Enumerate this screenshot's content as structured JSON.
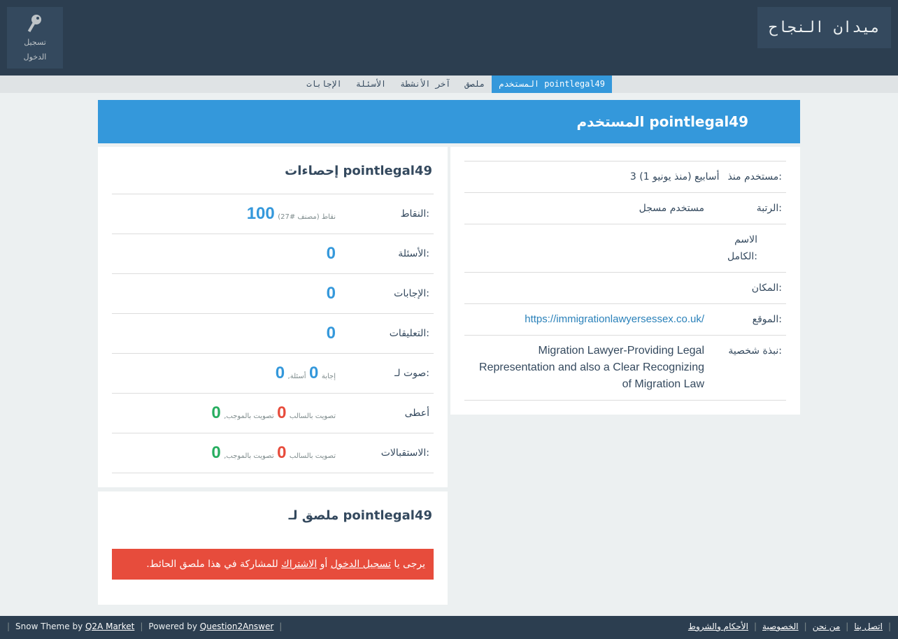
{
  "header": {
    "site_title": "ميدان النجاح",
    "login_label_1": "تسجيل",
    "login_label_2": "الدخول"
  },
  "nav": {
    "items": [
      {
        "label": "المستخدم pointlegal49",
        "active": true
      },
      {
        "label": "ملصق"
      },
      {
        "label": "آخر الأنشطة"
      },
      {
        "label": "الأسئلة"
      },
      {
        "label": "الإجابات"
      }
    ]
  },
  "page_title": "المستخدم pointlegal49",
  "profile": {
    "member_for_label": "مستخدم منذ:",
    "member_for_value": "3 أسابيع (منذ يونيو 1)",
    "type_label": "الرتبة:",
    "type_value": "مستخدم مسجل",
    "fullname_label_1": "الاسم",
    "fullname_label_2": "الكامل:",
    "location_label": "المكان:",
    "website_label": "الموقع:",
    "website_value": "https://immigrationlawyersessex.co.uk/",
    "about_label": "نبذة شخصية:",
    "about_value": "Migration Lawyer-Providing Legal Representation and also a Clear Recognizing of Migration Law"
  },
  "stats": {
    "title": "إحصاءات pointlegal49",
    "points_label": "النقاط:",
    "points_value": "100",
    "points_suffix": "نقاط (مصنف #27)",
    "questions_label": "الأسئلة:",
    "questions_value": "0",
    "answers_label": "الإجابات:",
    "answers_value": "0",
    "comments_label": "التعليقات:",
    "comments_value": "0",
    "voted_label": "صوت لـ:",
    "voted_q": "0",
    "voted_q_label": "أسئلة,",
    "voted_a": "0",
    "voted_a_label": "إجابة",
    "gave_label": "أعطى",
    "gave_up": "0",
    "gave_up_label": "تصويت بالموجب,",
    "gave_down": "0",
    "gave_down_label": "تصويت بالسالب",
    "received_label": "الاستقبالات:",
    "recv_up": "0",
    "recv_up_label": "تصويت بالموجب,",
    "recv_down": "0",
    "recv_down_label": "تصويت بالسالب"
  },
  "wall": {
    "title": "ملصق لـ pointlegal49",
    "msg_prefix": "يرجى يا ",
    "login_link": "تسجيل الدخول",
    "msg_or": " أو ",
    "register_link": "الاشتراك",
    "msg_suffix": " للمشاركة في هذا ملصق الحائط."
  },
  "footer": {
    "theme_text": "Snow Theme by ",
    "theme_link": "Q2A Market",
    "powered_text": "Powered by ",
    "powered_link": "Question2Answer",
    "links": [
      "اتصل بنا",
      "من نحن",
      "الخصوصية",
      "الأحكام والشروط"
    ]
  },
  "colors": {
    "header_bg": "#2c3e50",
    "accent_blue": "#3498db",
    "alert_red": "#e74c3c",
    "vote_green": "#27ae60"
  }
}
